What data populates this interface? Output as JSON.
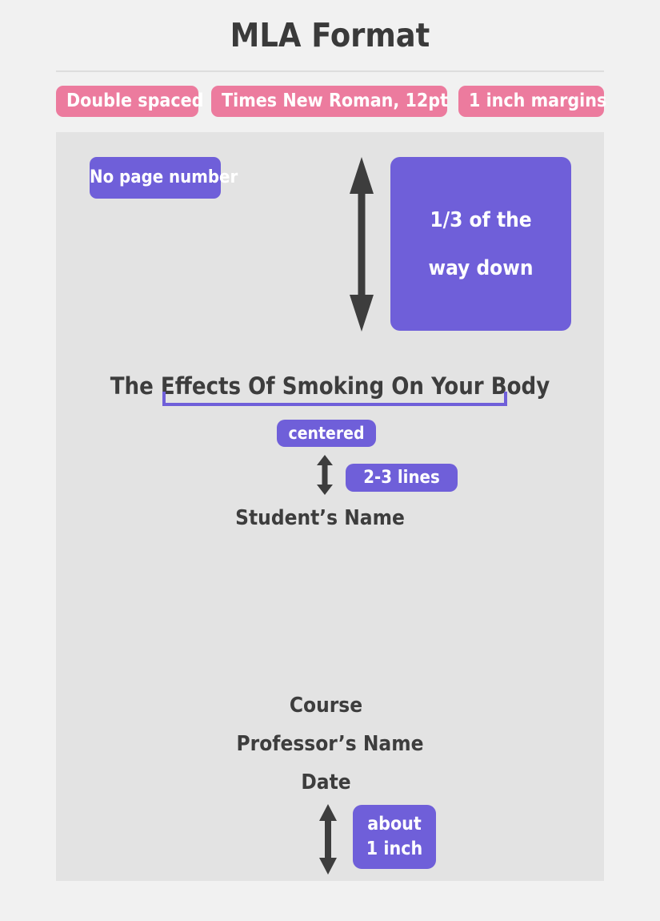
{
  "header": {
    "title": "MLA Format"
  },
  "requirements": [
    {
      "label": "Double spaced"
    },
    {
      "label": "Times New Roman, 12pt"
    },
    {
      "label": "1 inch margins"
    }
  ],
  "annotations": {
    "no_page_number": "No page number",
    "third_way_down_line1": "1/3 of the",
    "third_way_down_line2": "way down",
    "centered": "centered",
    "lines_spacing": "2-3 lines",
    "about_inch_line1": "about",
    "about_inch_line2": "1 inch"
  },
  "document": {
    "paper_title": "The Effects Of Smoking On Your Body",
    "student_name": "Student’s Name",
    "course": "Course",
    "professor_name": "Professor’s Name",
    "date": "Date"
  },
  "colors": {
    "background": "#f1f1f1",
    "paper": "#e3e3e3",
    "pink_badge": "#ec7b9e",
    "purple_badge": "#6f5fd9",
    "text_dark": "#3d3d3d",
    "title_text": "#3a3a3a",
    "divider": "#dddddd",
    "arrow": "#3d3d3d"
  },
  "icons": {
    "vertical_double_arrow": "double-headed-vertical-arrow",
    "title_bracket": "underline-bracket"
  }
}
